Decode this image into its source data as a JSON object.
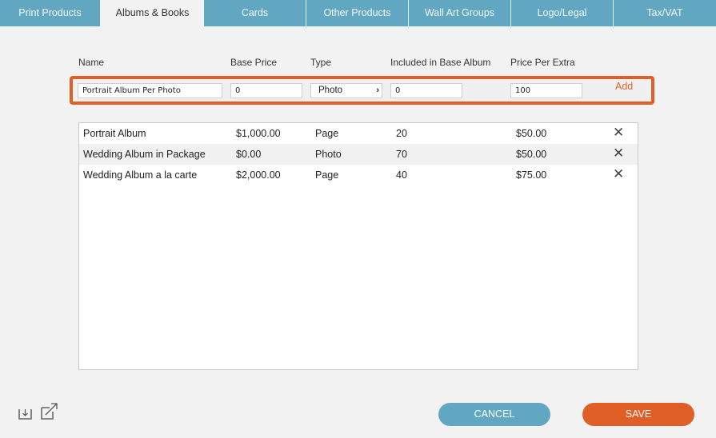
{
  "tabs": [
    {
      "label": "Print Products",
      "active": false
    },
    {
      "label": "Albums & Books",
      "active": true
    },
    {
      "label": "Cards",
      "active": false
    },
    {
      "label": "Other Products",
      "active": false
    },
    {
      "label": "Wall Art Groups",
      "active": false
    },
    {
      "label": "Logo/Legal",
      "active": false
    },
    {
      "label": "Tax/VAT",
      "active": false
    }
  ],
  "columns": {
    "name": "Name",
    "base_price": "Base Price",
    "type": "Type",
    "included": "Included in Base Album",
    "price_per_extra": "Price Per Extra"
  },
  "new_entry": {
    "name": "Portrait Album Per Photo",
    "base_price": "0",
    "type": "Photo",
    "included": "0",
    "price_per_extra": "100",
    "add_label": "Add",
    "type_chevron": "›"
  },
  "albums": [
    {
      "name": "Portrait Album",
      "base_price": "$1,000.00",
      "type": "Page",
      "included": "20",
      "price_per_extra": "$50.00"
    },
    {
      "name": "Wedding Album in Package",
      "base_price": "$0.00",
      "type": "Photo",
      "included": "70",
      "price_per_extra": "$50.00"
    },
    {
      "name": "Wedding Album a la carte",
      "base_price": "$2,000.00",
      "type": "Page",
      "included": "40",
      "price_per_extra": "$75.00"
    }
  ],
  "delete_glyph": "✕",
  "footer": {
    "icons": [
      "import-icon",
      "export-icon"
    ],
    "cancel_label": "CANCEL",
    "save_label": "SAVE"
  },
  "colors": {
    "tab_bar": "#62a7c2",
    "accent": "#e05f26"
  }
}
